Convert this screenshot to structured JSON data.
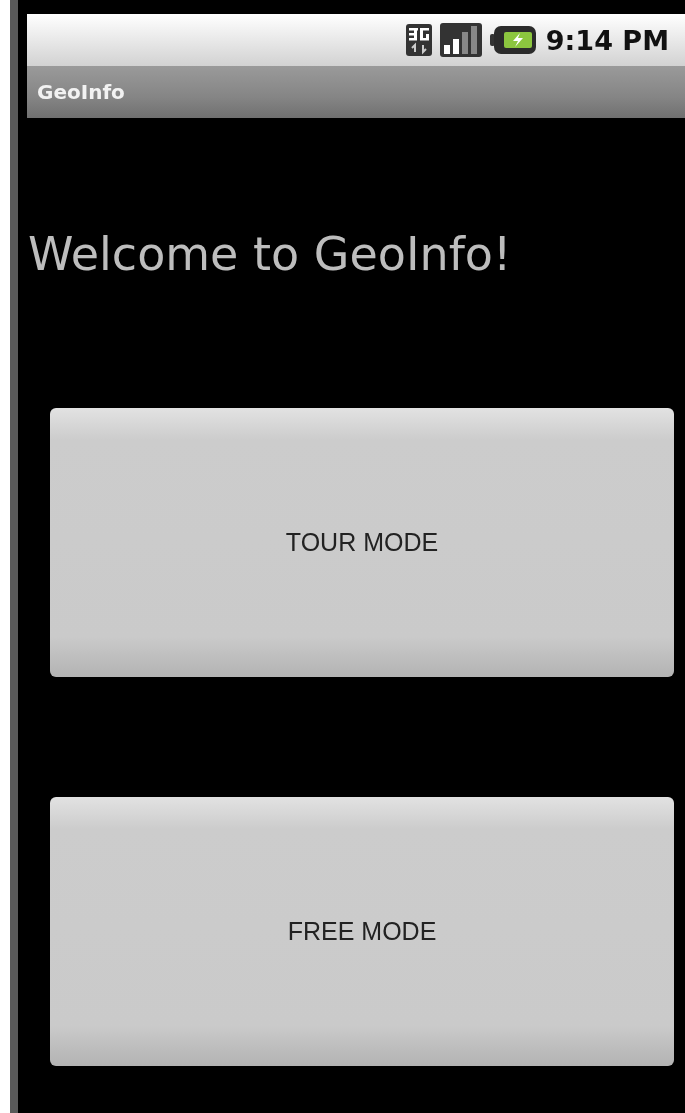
{
  "status_bar": {
    "time": "9:14 PM"
  },
  "title_bar": {
    "title": "GeoInfo"
  },
  "heading": "Welcome to GeoInfo!",
  "buttons": [
    {
      "label": "TOUR MODE"
    },
    {
      "label": "FREE MODE"
    }
  ]
}
